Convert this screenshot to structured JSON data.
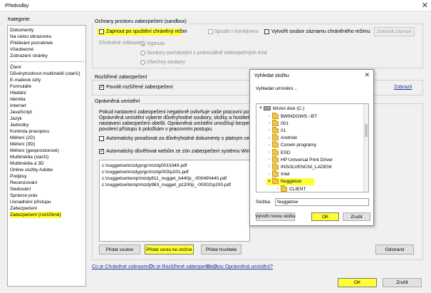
{
  "window": {
    "title": "Předvolby",
    "close_glyph": "✕"
  },
  "categories": {
    "label": "Kategorie:",
    "top": [
      "Dokumenty",
      "Na celou obrazovku",
      "Přidávání poznámek",
      "Všeobecné",
      "Zobrazení stránky"
    ],
    "rest": [
      "Čtení",
      "Důvěryhodnost multimédií (starší)",
      "E-mailové účty",
      "Formuláře",
      "Hledání",
      "Identita",
      "Internet",
      "JavaScript",
      "Jazyk",
      "Jednotky",
      "Kontrola pravopisu",
      "Měření (2D)",
      "Měření (3D)",
      "Měření (geoprostorové)",
      "Multimédia (starší)",
      "Multimédia a 3D",
      "Online služby Adobe",
      "Podpisy",
      "Recenzování",
      "Sledování",
      "Správce práv",
      "Usnadnění přístupu",
      "Zabezpečení",
      "Zabezpečení (rozšířené)"
    ],
    "selected": "Zabezpečení (rozšířené)"
  },
  "sandbox": {
    "title": "Ochrany prostoru zabezpečení (sandbox)",
    "protected_mode": "Zapnout po spuštění chráněný režim",
    "container": "Spustit v kontejneru",
    "log": "Vytvořit soubor záznamu chráněného režimu",
    "view_log": "Zobrazit záznam",
    "protected_view_label": "Chráněné zobrazení",
    "radios": [
      "Vypnuto",
      "Soubory pocházející z potenciálně nebezpečných míst",
      "Všechny soubory"
    ]
  },
  "enhanced": {
    "title": "Rozšířené zabezpečení",
    "enable": "Povolit rozšířené zabezpečení",
    "view_link": "Zobrazit"
  },
  "privileged": {
    "title": "Oprávněná umístění",
    "desc": [
      "Pokud nastavení zabezpečení negativně ovlivňuje vaše pracovní postupy, pom",
      "Oprávněná umístění vyberte důvěryhodné soubory, složky a hostitele, abyste c",
      "nastavení zabezpečení obešli. Oprávněná umístění umožňují bezpečnou prací",
      "povolení přístupu k položkám v pracovním postupu."
    ],
    "auto_trust": "Automaticky považovat za důvěryhodné dokumenty s platným certifikáter",
    "auto_trust_sites": "Automaticky důvěřovat webům ze zón zabezpečení systému Windows",
    "paths": [
      "c:\\nuggetsw\\mzdyprgc\\mzdy001\\l349.pdf",
      "c:\\nuggetsw\\mzdyprgc\\mzdy003\\p201.pdf",
      "c:\\nuggetsw\\temp\\mzdy811_nugget_b440p_-00049\\l440.pdf",
      "c:\\nuggetsw\\temp\\mzdy983_nugget_pz200p_-00002\\p200.pdf"
    ],
    "add_file": "Přidat soubor",
    "add_folder": "Přidat cestu ke složce",
    "add_host": "Přidat hostitele",
    "remove": "Odstranit"
  },
  "links": [
    "Co je Chráněné zobrazení?",
    "Co je Rozšířené zabezpečení?",
    "Co jsou Oprávněná umístění?"
  ],
  "footer": {
    "ok": "OK",
    "cancel": "Zrušit"
  },
  "dialog": {
    "title": "Vyhledat složku",
    "subtitle": "Vyhledat umístění...",
    "drive": "Místní disk (C:)",
    "folders": [
      "$WINDOWS.~BT",
      "001",
      "01",
      "Android",
      "Corwin programy",
      "ESD",
      "HP Universal Print Driver",
      "INSOLVENCNI_LADENI",
      "Intel",
      "Nuggetsw",
      "CLIENT"
    ],
    "selected_folder": "Nuggetsw",
    "folder_label": "Složka:",
    "folder_value": "Nuggetsw",
    "new_folder": "Vytvořit novou složku",
    "ok": "OK",
    "cancel": "Zrušit"
  },
  "colors": {
    "highlight": "#ffff33",
    "link": "#1a3a8f",
    "folder": "#f4c544"
  }
}
